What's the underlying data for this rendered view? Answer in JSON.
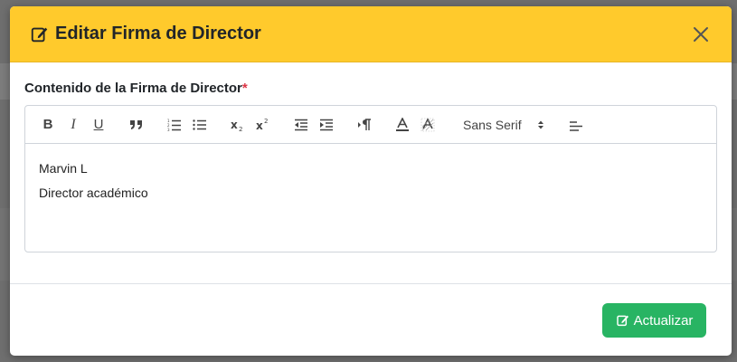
{
  "modal": {
    "title": "Editar Firma de Director",
    "title_icon": "edit-icon",
    "close_icon": "close-icon",
    "colors": {
      "header": "#ffca2c",
      "required": "#dc3545",
      "primary_button": "#28b463"
    }
  },
  "form": {
    "label": "Contenido de la Firma de Director",
    "required_mark": "*"
  },
  "editor": {
    "toolbar": {
      "bold": "B",
      "italic": "I",
      "underline": "U",
      "font_select": "Sans Serif"
    },
    "content": [
      "Marvin L",
      "Director académico"
    ]
  },
  "footer": {
    "update_label": "Actualizar",
    "update_icon": "edit-icon"
  }
}
